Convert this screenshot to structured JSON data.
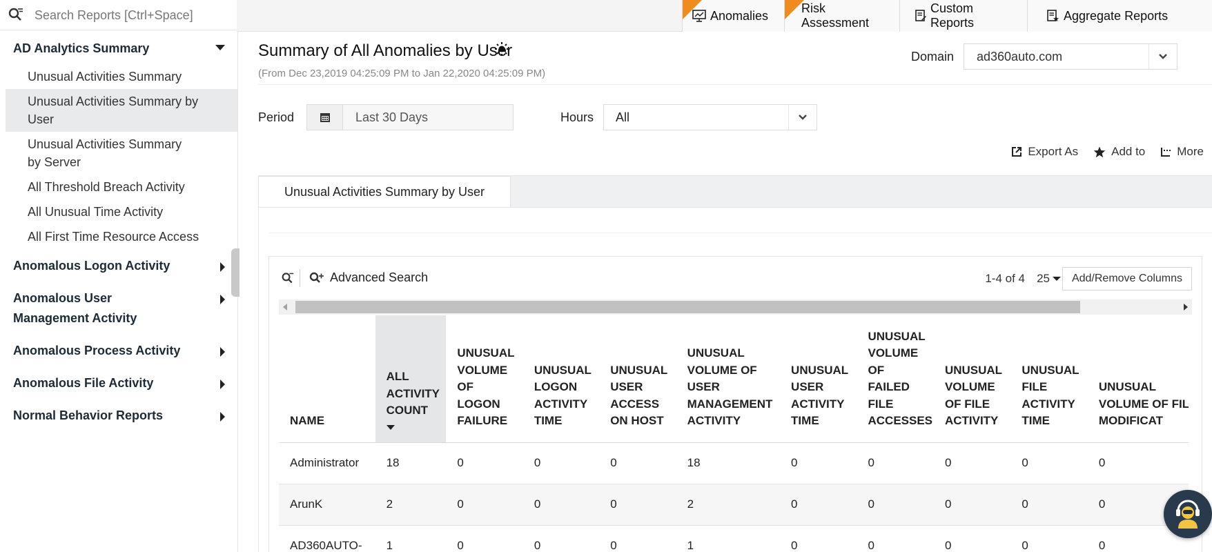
{
  "search": {
    "placeholder": "Search Reports [Ctrl+Space]"
  },
  "top_tabs": [
    {
      "label": "Anomalies",
      "new_badge": true
    },
    {
      "label": "Risk Assessment",
      "new_badge": true
    },
    {
      "label": "Custom Reports",
      "new_badge": false
    },
    {
      "label": "Aggregate Reports",
      "new_badge": false
    }
  ],
  "sidebar": {
    "groups": [
      {
        "label": "AD Analytics Summary",
        "expanded": true,
        "items": [
          {
            "label": "Unusual Activities Summary",
            "active": false
          },
          {
            "label": "Unusual Activities Summary by User",
            "active": true
          },
          {
            "label": "Unusual Activities Summary by Server",
            "active": false
          },
          {
            "label": "All Threshold Breach Activity",
            "active": false
          },
          {
            "label": "All Unusual Time Activity",
            "active": false
          },
          {
            "label": "All First Time Resource Access",
            "active": false
          }
        ]
      },
      {
        "label": "Anomalous Logon Activity",
        "expanded": false
      },
      {
        "label": "Anomalous User Management Activity",
        "expanded": false
      },
      {
        "label": "Anomalous Process Activity",
        "expanded": false
      },
      {
        "label": "Anomalous File Activity",
        "expanded": false
      },
      {
        "label": "Normal Behavior Reports",
        "expanded": false
      }
    ]
  },
  "main": {
    "title": "Summary of All Anomalies by User",
    "date_range": "(From Dec 23,2019 04:25:09 PM to Jan 22,2020 04:25:09 PM)",
    "domain_label": "Domain",
    "domain_value": "ad360auto.com",
    "period_label": "Period",
    "period_value": "Last 30 Days",
    "hours_label": "Hours",
    "hours_value": "All",
    "actions": {
      "export": "Export As",
      "add_to": "Add to",
      "more": "More"
    },
    "report_tab": "Unusual Activities Summary by User"
  },
  "grid": {
    "advanced_search": "Advanced Search",
    "record_count": "1-4 of 4",
    "page_size": "25",
    "add_remove_columns": "Add/Remove Columns",
    "columns": [
      "NAME",
      "ALL ACTIVITY COUNT",
      "UNUSUAL VOLUME OF LOGON FAILURE",
      "UNUSUAL LOGON ACTIVITY TIME",
      "UNUSUAL USER ACCESS ON HOST",
      "UNUSUAL VOLUME OF USER MANAGEMENT ACTIVITY",
      "UNUSUAL USER ACTIVITY TIME",
      "UNUSUAL VOLUME OF FAILED FILE ACCESSES",
      "UNUSUAL VOLUME OF FILE ACTIVITY",
      "UNUSUAL FILE ACTIVITY TIME",
      "UNUSUAL VOLUME OF FILE MODIFICAT"
    ],
    "sorted_column": 1,
    "rows": [
      [
        "Administrator",
        "18",
        "0",
        "0",
        "0",
        "18",
        "0",
        "0",
        "0",
        "0",
        "0"
      ],
      [
        "ArunK",
        "2",
        "0",
        "0",
        "0",
        "2",
        "0",
        "0",
        "0",
        "0",
        "0"
      ],
      [
        "AD360AUTO-",
        "1",
        "0",
        "0",
        "0",
        "1",
        "0",
        "0",
        "0",
        "0",
        "0"
      ]
    ]
  },
  "colors": {
    "ribbon": "#f08c1e",
    "sorted_header": "#e4e6e7",
    "chat": "#2a3a4d"
  }
}
